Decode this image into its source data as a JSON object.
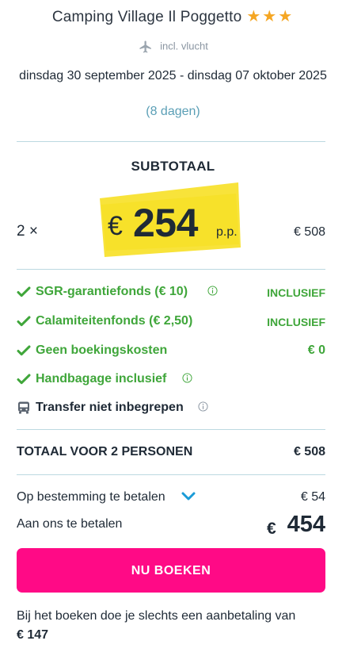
{
  "header": {
    "title": "Camping Village Il Poggetto",
    "stars": "★★★",
    "flight_label": "incl. vlucht",
    "flight_icon": "airplane-icon",
    "dates": "dinsdag 30 september 2025 - dinsdag 07 oktober 2025",
    "duration": "(8 dagen)"
  },
  "subtotal": {
    "heading": "SUBTOTAAL",
    "quantity": "2 ×",
    "currency": "€",
    "price_per_person": "254",
    "pp_label": "p.p.",
    "amount": "€ 508"
  },
  "items": [
    {
      "label": "SGR-garantiefonds  (€ 10)",
      "value": "INCLUSIEF",
      "icon": "checkmark-icon",
      "info": true
    },
    {
      "label": "Calamiteitenfonds  (€ 2,50)",
      "value": "INCLUSIEF",
      "icon": "checkmark-icon",
      "info": false
    },
    {
      "label": "Geen boekingskosten",
      "value": "€ 0",
      "icon": "checkmark-icon",
      "info": false
    },
    {
      "label": "Handbagage inclusief",
      "value": "",
      "icon": "checkmark-icon",
      "info": true
    },
    {
      "label": "Transfer niet inbegrepen",
      "value": "",
      "icon": "bus-icon",
      "info": true
    }
  ],
  "totals": {
    "total_label": "TOTAAL VOOR 2 PERSONEN",
    "total_value": "€ 508",
    "destination_label": "Op bestemming te betalen",
    "destination_value": "€ 54",
    "pay_label": "Aan ons te betalen",
    "pay_currency": "€",
    "pay_value": "454"
  },
  "cta": {
    "book_label": "NU BOEKEN"
  },
  "note": {
    "text": "Bij het boeken doe je slechts een aanbetaling van",
    "amount": "€ 147"
  },
  "colors": {
    "accent_pink": "#ff0a86",
    "success_green": "#3fa63a",
    "star_orange": "#f5a623",
    "highlight_yellow": "#f8e33a",
    "divider": "#bcd9e1",
    "chevron_blue": "#1a9bd7"
  }
}
